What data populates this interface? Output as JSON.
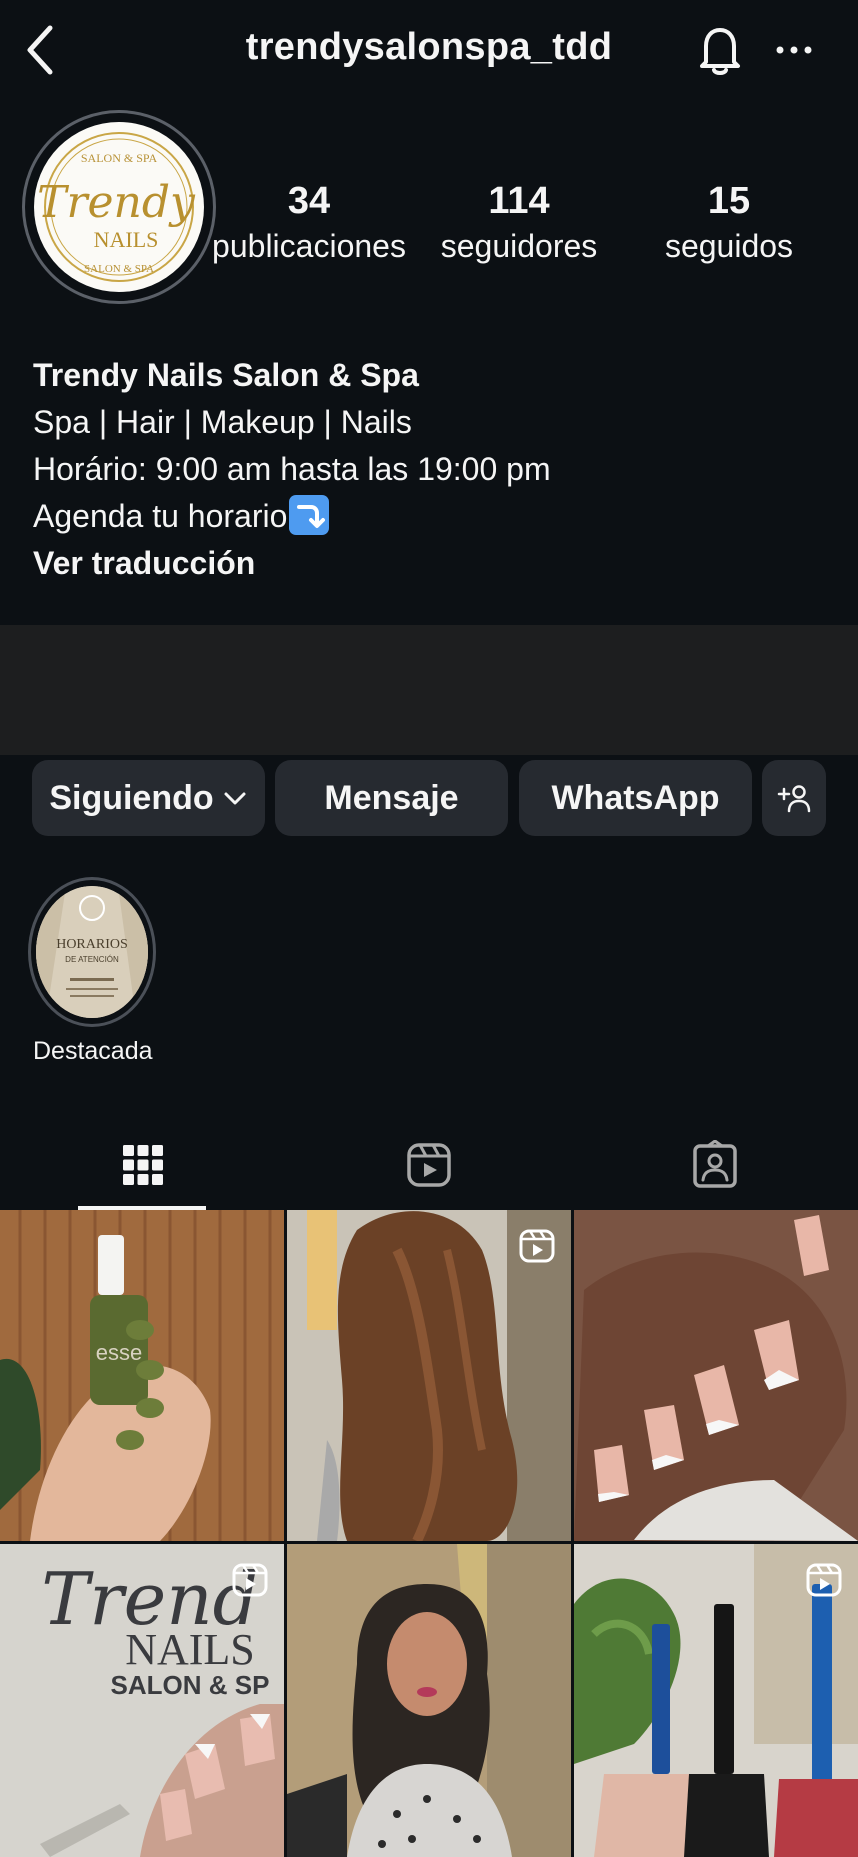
{
  "header": {
    "username": "trendysalonspa_tdd",
    "back_icon": "chevron-left-icon",
    "bell_icon": "bell-icon",
    "more_icon": "more-horizontal-icon"
  },
  "profile": {
    "avatar_text": {
      "line1": "Trendy",
      "line2": "NAILS",
      "ring_top": "SALON & SPA",
      "ring_bottom": "SALON & SPA"
    },
    "stats": [
      {
        "value": "34",
        "label": "publicaciones"
      },
      {
        "value": "114",
        "label": "seguidores"
      },
      {
        "value": "15",
        "label": "seguidos"
      }
    ],
    "bio": {
      "name": "Trendy Nails Salon & Spa",
      "line1": "Spa | Hair | Makeup | Nails",
      "line2": "Horário: 9:00 am hasta las 19:00 pm",
      "line3": "Agenda tu horario",
      "translate": "Ver traducción"
    }
  },
  "actions": {
    "following": "Siguiendo",
    "message": "Mensaje",
    "whatsapp": "WhatsApp",
    "add_user_icon": "add-person-icon"
  },
  "highlight": {
    "label": "Destacada",
    "cover_text": {
      "title": "HORARIOS",
      "subtitle": "DE ATENCIÓN"
    }
  },
  "tabs": [
    {
      "name": "grid",
      "icon": "grid-icon",
      "active": true
    },
    {
      "name": "reels",
      "icon": "reels-icon",
      "active": false
    },
    {
      "name": "tagged",
      "icon": "tagged-icon",
      "active": false
    }
  ],
  "posts": [
    {
      "subject": "olive-green nail polish",
      "is_reel": false
    },
    {
      "subject": "brown wavy hair",
      "is_reel": true
    },
    {
      "subject": "french tip nails",
      "is_reel": false
    },
    {
      "subject": "embroidered logo with nails",
      "is_reel": true,
      "text": {
        "line1": "Trend",
        "line2": "NAILS",
        "line3": "SALON & SP"
      }
    },
    {
      "subject": "makeup portrait",
      "is_reel": false
    },
    {
      "subject": "nail polish bottles",
      "is_reel": true
    }
  ],
  "colors": {
    "background": "#0c1014",
    "button": "#262a30",
    "text": "#f5f5f5",
    "accent_arrow": "#4e9bf0"
  }
}
